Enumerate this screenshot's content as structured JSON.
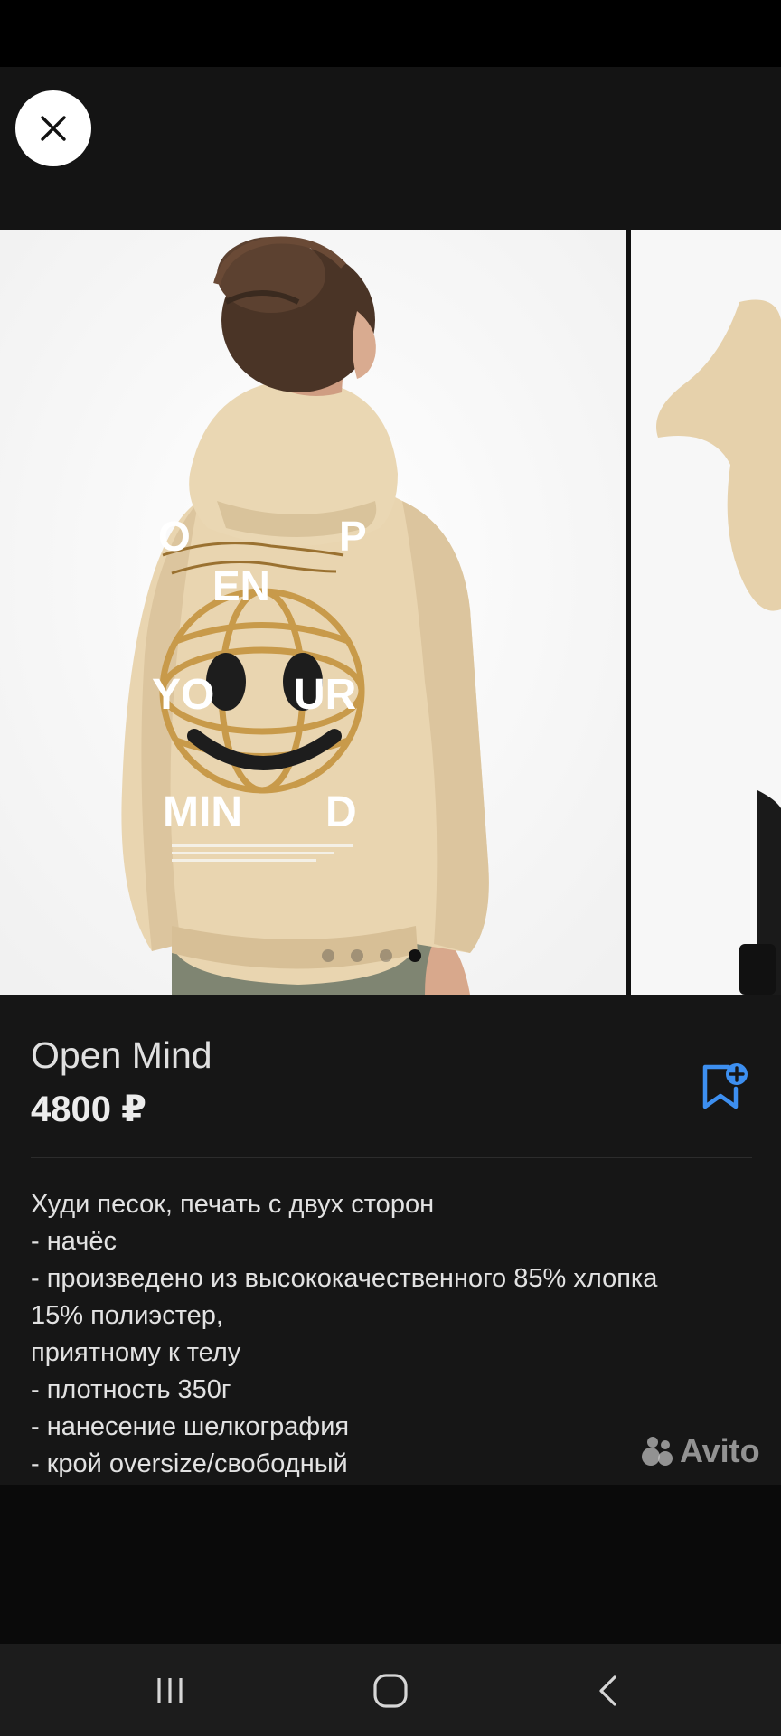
{
  "listing": {
    "title": "Open Mind",
    "price": "4800 ₽"
  },
  "gallery": {
    "image_count": 4,
    "active_index": 3,
    "print_text": [
      "O",
      "P",
      "EN",
      "YO",
      "UR",
      "MIN",
      "D"
    ]
  },
  "description": {
    "lines": [
      "Худи песок, печать с двух сторон",
      "- начёс",
      "- произведено из высококачественного 85% хлопка",
      "15% полиэстер,",
      "приятному к телу",
      "- плотность 350г",
      "- нанесение шелкография",
      "- крой oversize/свободный"
    ]
  },
  "watermark": {
    "text": "Avito"
  },
  "icons": {
    "close": "close-icon",
    "favorite": "bookmark-add-icon",
    "recents": "recent-apps-icon",
    "home": "home-icon",
    "back": "back-icon"
  },
  "colors": {
    "accent": "#3d8ff0",
    "background": "#161616",
    "hoodie": "#e9d5b0"
  }
}
